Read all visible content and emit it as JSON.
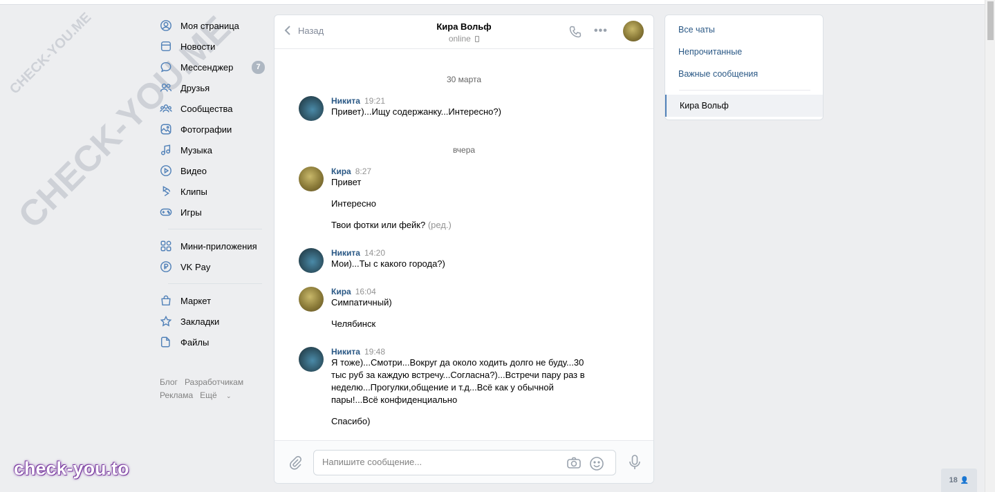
{
  "nav": {
    "items": [
      {
        "label": "Моя страница",
        "icon": "user-circle-icon"
      },
      {
        "label": "Новости",
        "icon": "news-icon"
      },
      {
        "label": "Мессенджер",
        "icon": "message-icon",
        "badge": "7"
      },
      {
        "label": "Друзья",
        "icon": "friends-icon"
      },
      {
        "label": "Сообщества",
        "icon": "communities-icon"
      },
      {
        "label": "Фотографии",
        "icon": "photo-icon"
      },
      {
        "label": "Музыка",
        "icon": "music-icon"
      },
      {
        "label": "Видео",
        "icon": "video-icon"
      },
      {
        "label": "Клипы",
        "icon": "clips-icon"
      },
      {
        "label": "Игры",
        "icon": "gamepad-icon"
      }
    ],
    "items2": [
      {
        "label": "Мини-приложения",
        "icon": "apps-icon"
      },
      {
        "label": "VK Pay",
        "icon": "vkpay-icon"
      }
    ],
    "items3": [
      {
        "label": "Маркет",
        "icon": "market-icon"
      },
      {
        "label": "Закладки",
        "icon": "star-icon"
      },
      {
        "label": "Файлы",
        "icon": "file-icon"
      }
    ],
    "footer": {
      "blog": "Блог",
      "dev": "Разработчикам",
      "ads": "Реклама",
      "more": "Ещё"
    }
  },
  "watermark": {
    "small": "CHECK-YOU.ME",
    "large": "CHECK-YOU.ME",
    "brand": "check-you.to"
  },
  "chat": {
    "back_label": "Назад",
    "peer_name": "Кира Вольф",
    "peer_status": "online",
    "dates": [
      "30 марта",
      "вчера"
    ],
    "messages": [
      {
        "author": "Никита",
        "time": "19:21",
        "lines": [
          "Привет)...Ищу содержанку...Интересно?)"
        ]
      },
      {
        "author": "Кира",
        "time": "8:27",
        "lines": [
          "Привет",
          "Интересно",
          "Твои фотки или фейк?"
        ],
        "edited": "(ред.)"
      },
      {
        "author": "Никита",
        "time": "14:20",
        "lines": [
          "Мои)...Ты с какого города?)"
        ]
      },
      {
        "author": "Кира",
        "time": "16:04",
        "lines": [
          "Симпатичный)",
          "Челябинск"
        ]
      },
      {
        "author": "Никита",
        "time": "19:48",
        "lines": [
          "Я тоже)...Смотри...Вокруг да около ходить долго не буду...30",
          "тыс руб за каждую встречу...Согласна?)...Встречи пару раз в",
          "неделю...Прогулки,общение и т.д...Всё как у обычной",
          "пары!...Всё конфиденциально",
          "Спасибо)"
        ]
      }
    ],
    "composer_placeholder": "Напишите сообщение..."
  },
  "right_panel": {
    "all_chats": "Все чаты",
    "unread": "Непрочитанные",
    "important": "Важные сообщения",
    "active_chat": "Кира Вольф"
  },
  "online_widget": {
    "count": "18"
  },
  "colors": {
    "accent": "#5181b8",
    "link": "#2a5885",
    "background": "#edeef0"
  }
}
